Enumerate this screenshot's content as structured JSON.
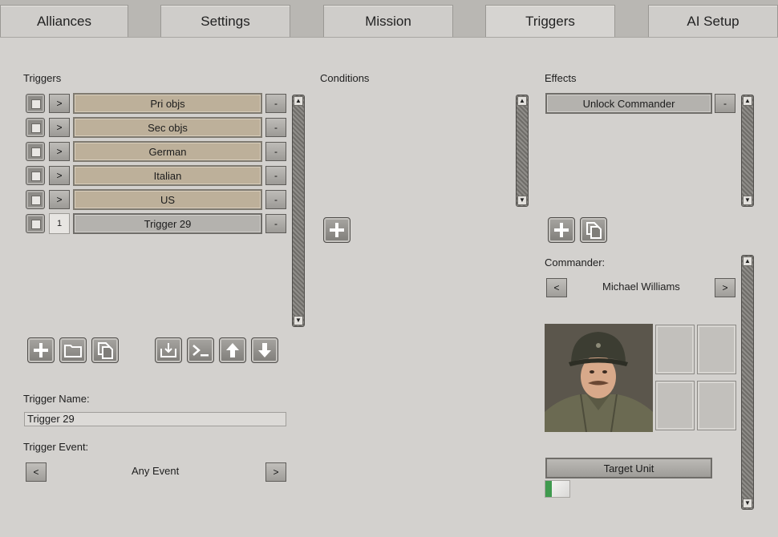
{
  "tabs": [
    {
      "label": "Alliances",
      "active": false
    },
    {
      "label": "Settings",
      "active": false
    },
    {
      "label": "Mission",
      "active": false
    },
    {
      "label": "Triggers",
      "active": true
    },
    {
      "label": "AI Setup",
      "active": false
    }
  ],
  "triggers": {
    "heading": "Triggers",
    "expand_symbol": ">",
    "remove_symbol": "-",
    "items": [
      {
        "label": "Pri objs",
        "style": "folder"
      },
      {
        "label": "Sec objs",
        "style": "folder"
      },
      {
        "label": "German",
        "style": "folder"
      },
      {
        "label": "Italian",
        "style": "folder"
      },
      {
        "label": "US",
        "style": "folder"
      },
      {
        "label": "Trigger 29",
        "style": "trigger",
        "index": "1"
      }
    ],
    "toolbar_icons": [
      "add-icon",
      "folder-icon",
      "copy-icon",
      "import-icon",
      "console-icon",
      "arrow-up-icon",
      "arrow-down-icon"
    ],
    "name_label": "Trigger Name:",
    "name_value": "Trigger 29",
    "event_label": "Trigger Event:",
    "event_value": "Any Event",
    "prev_symbol": "<",
    "next_symbol": ">"
  },
  "conditions": {
    "heading": "Conditions",
    "add_icon": "add-icon"
  },
  "effects": {
    "heading": "Effects",
    "items": [
      {
        "label": "Unlock Commander"
      }
    ],
    "remove_symbol": "-",
    "add_icon": "add-icon",
    "copy_icon": "copy-icon",
    "commander_label": "Commander:",
    "commander_value": "Michael Williams",
    "prev_symbol": "<",
    "next_symbol": ">",
    "target_unit_label": "Target Unit",
    "progress": 0.25
  },
  "colors": {
    "folder_fill": "#bdb09a",
    "progress_fill": "#3f9a4e"
  }
}
